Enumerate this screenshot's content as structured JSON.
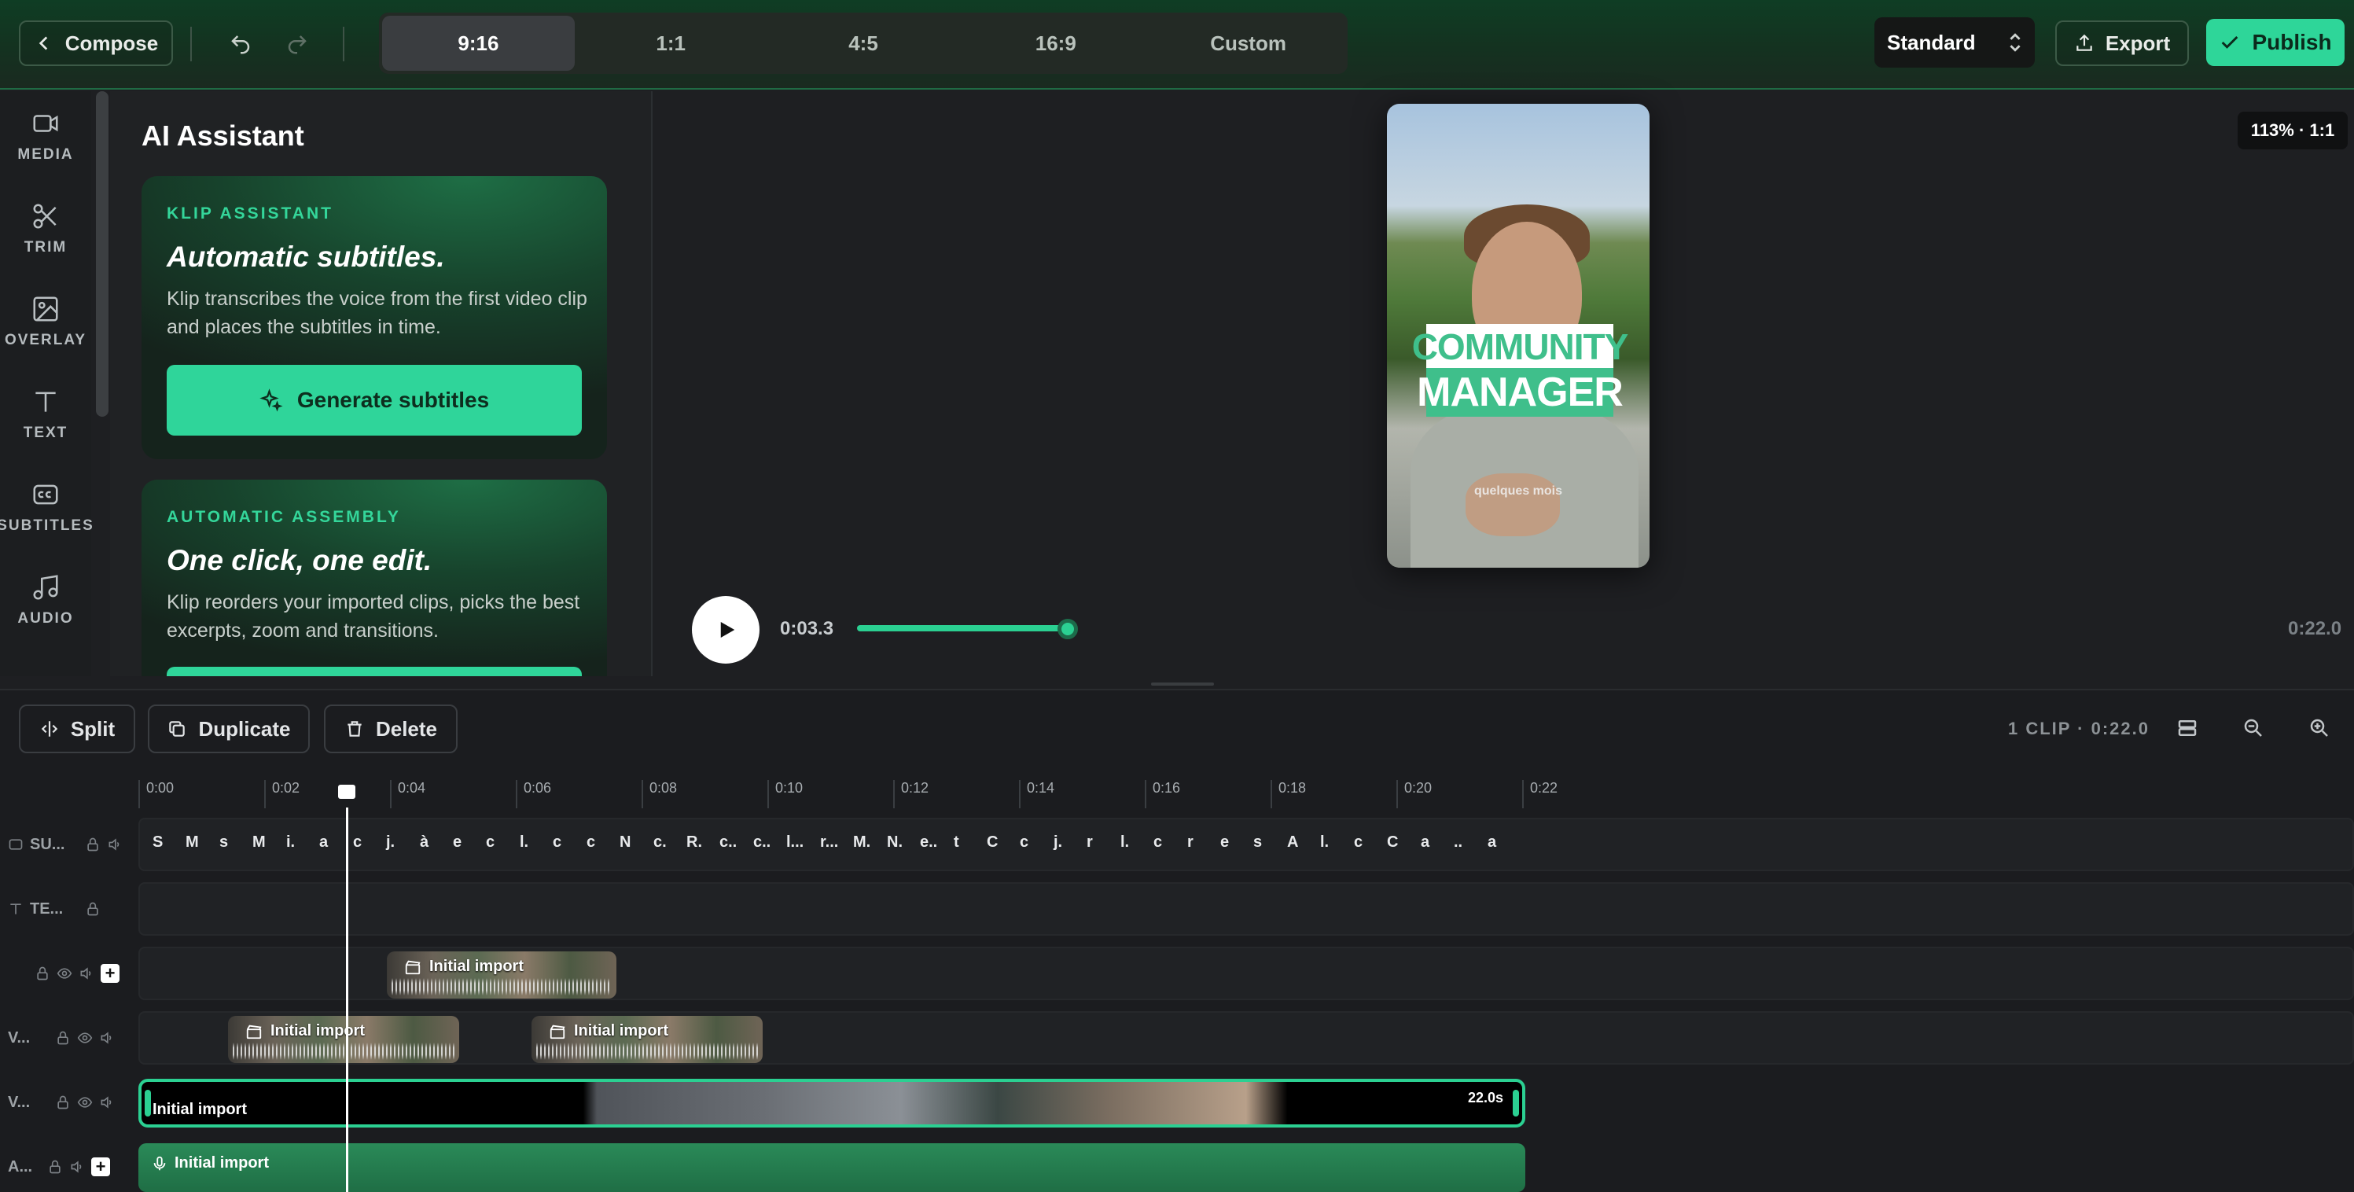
{
  "topbar": {
    "compose_label": "Compose",
    "ratios": [
      "9:16",
      "1:1",
      "4:5",
      "16:9",
      "Custom"
    ],
    "active_ratio": "9:16",
    "quality": "Standard",
    "export_label": "Export",
    "publish_label": "Publish"
  },
  "rail": {
    "items": [
      {
        "label": "MEDIA",
        "icon": "video-camera-icon"
      },
      {
        "label": "TRIM",
        "icon": "scissors-icon"
      },
      {
        "label": "OVERLAY",
        "icon": "image-icon"
      },
      {
        "label": "TEXT",
        "icon": "text-icon"
      },
      {
        "label": "SUBTITLES",
        "icon": "cc-icon"
      },
      {
        "label": "AUDIO",
        "icon": "music-note-icon"
      }
    ]
  },
  "panel": {
    "title": "AI Assistant",
    "cards": [
      {
        "kicker": "KLIP ASSISTANT",
        "title": "Automatic subtitles.",
        "description": "Klip transcribes the voice from the first video clip and places the subtitles in time.",
        "button": "Generate subtitles"
      },
      {
        "kicker": "AUTOMATIC ASSEMBLY",
        "title": "One click, one edit.",
        "description": "Klip reorders your imported clips, picks the best excerpts, zoom and transitions."
      }
    ]
  },
  "preview": {
    "zoom_badge": "113% · 1:1",
    "overlay_line1": "COMMUNITY",
    "overlay_line2": "MANAGER",
    "caption": "quelques mois",
    "current_time": "0:03.3",
    "total_time": "0:22.0",
    "progress": 0.15
  },
  "edit_toolbar": {
    "split_label": "Split",
    "duplicate_label": "Duplicate",
    "delete_label": "Delete",
    "clip_info": "1 CLIP · 0:22.0"
  },
  "timeline": {
    "ticks": [
      "0:00",
      "0:02",
      "0:04",
      "0:06",
      "0:08",
      "0:10",
      "0:12",
      "0:14",
      "0:16",
      "0:18",
      "0:20",
      "0:22"
    ],
    "tracks": {
      "subtitles": "SU...",
      "text": "TE...",
      "video_a": "V...",
      "video_main": "V...",
      "audio": "A..."
    },
    "subtitle_chips": [
      "S",
      "M",
      "s",
      "M",
      "i.",
      "a",
      "c",
      "j.",
      "à",
      "e",
      "c",
      "l.",
      "c",
      "c",
      "N",
      "c.",
      "R.",
      "c..",
      "c..",
      "l...",
      "r...",
      "M.",
      "N.",
      "e..",
      "t",
      "C",
      "c",
      "j.",
      "r",
      "l.",
      "c",
      "r",
      "e",
      "s",
      "A",
      "l.",
      "c",
      "C",
      "a",
      "..",
      "a"
    ],
    "clip_label": "Initial import",
    "main_clip_duration": "22.0s"
  },
  "colors": {
    "accent": "#2ed699",
    "topbar": "#0f3d24",
    "background": "#1e1f22"
  }
}
